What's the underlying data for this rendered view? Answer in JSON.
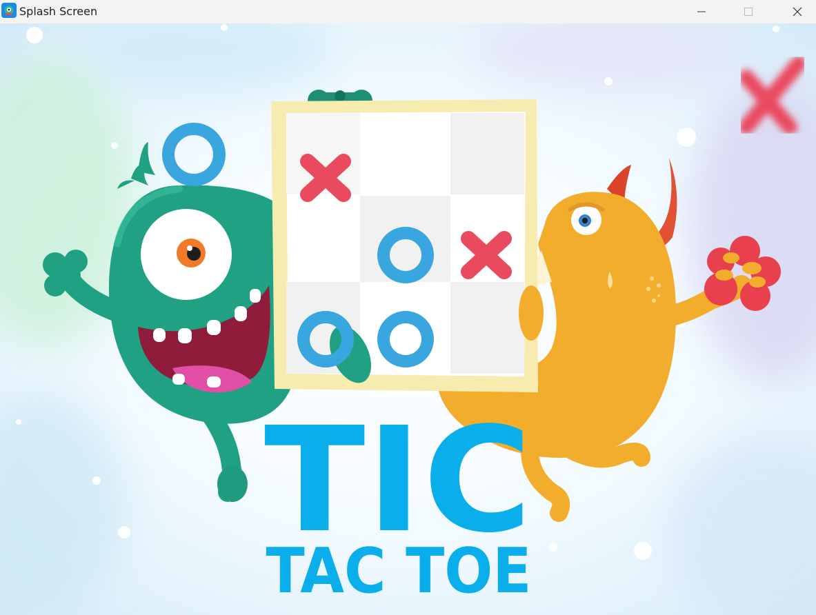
{
  "window": {
    "title": "Splash Screen",
    "icons": {
      "app": "monster-app-icon",
      "minimize": "minimize-icon",
      "maximize": "maximize-icon",
      "close": "close-icon"
    }
  },
  "splash": {
    "title_line1": "TIC",
    "title_line2": "TAC TOE",
    "board": [
      "X",
      "",
      "",
      "",
      "O",
      "X",
      "O",
      "O",
      ""
    ],
    "colors": {
      "title": "#0aaeea",
      "x_mark": "#ea4a5e",
      "o_mark": "#39a6df",
      "green_monster": "#21a184",
      "orange_monster": "#f3ad2c",
      "board_frame": "#f7ecb0"
    }
  }
}
